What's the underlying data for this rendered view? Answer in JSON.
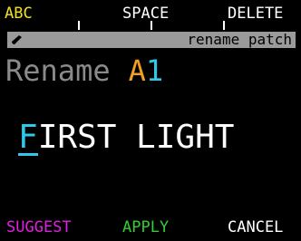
{
  "colors": {
    "background": "#000000",
    "abc_key": "#f0e020",
    "softkey": "#ffffff",
    "header_bar": "#9a9a9a",
    "rename_label": "#8a8a8a",
    "bank_letter": "#f0a020",
    "slot_number": "#30c8e8",
    "cursor": "#30c8e8",
    "suggest": "#e020e0",
    "apply": "#30d030",
    "cancel": "#ffffff"
  },
  "softkeys": {
    "abc": "ABC",
    "space": "SPACE",
    "delete": "DELETE"
  },
  "header": {
    "icon": "pencil-icon",
    "text": "rename patch"
  },
  "rename": {
    "label": "Rename",
    "bank": "A",
    "slot": "1"
  },
  "name_editor": {
    "cursor_char": "F",
    "rest": "IRST LIGHT"
  },
  "bottom_keys": {
    "suggest": "SUGGEST",
    "apply": "APPLY",
    "cancel": "CANCEL"
  }
}
